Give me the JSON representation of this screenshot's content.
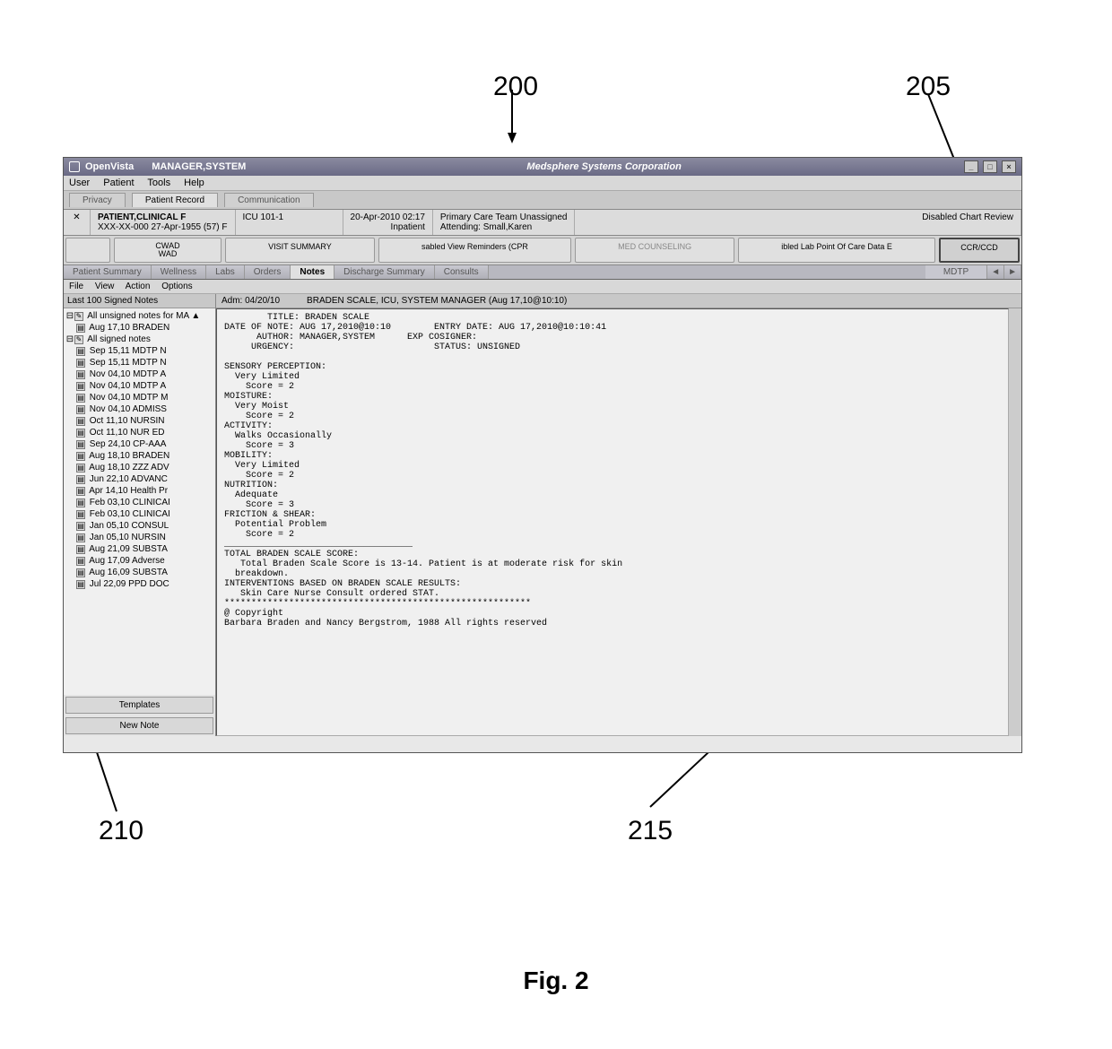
{
  "callouts": {
    "c200": "200",
    "c205": "205",
    "c210": "210",
    "c215": "215",
    "fig": "Fig. 2"
  },
  "titlebar": {
    "app": "OpenVista",
    "user": "MANAGER,SYSTEM",
    "center": "Medsphere Systems Corporation"
  },
  "menus": [
    "User",
    "Patient",
    "Tools",
    "Help"
  ],
  "tabrow1": [
    {
      "label": "Privacy"
    },
    {
      "label": "Patient Record",
      "active": true
    },
    {
      "label": "Communication"
    }
  ],
  "patient": {
    "name": "PATIENT,CLINICAL F",
    "ssn_dob_sex": "XXX-XX-000 27-Apr-1955 (57)   F",
    "loc": "ICU  101-1",
    "datetime": "20-Apr-2010 02:17",
    "inout": "Inpatient",
    "team": "Primary Care Team Unassigned",
    "attending": "Attending: Small,Karen",
    "right": "Disabled Chart Review"
  },
  "btnrow": [
    {
      "label": "",
      "dim": true
    },
    {
      "label": "CWAD\nWAD"
    },
    {
      "label": "VISIT SUMMARY"
    },
    {
      "label": "sabled View Reminders (CPR"
    },
    {
      "label": "MED COUNSELING",
      "dim": true
    },
    {
      "label": "ibled Lab Point Of Care Data E"
    },
    {
      "label": "CCR/CCD",
      "highlight": true
    }
  ],
  "viewtabs": [
    {
      "label": "Patient Summary"
    },
    {
      "label": "Wellness"
    },
    {
      "label": "Labs"
    },
    {
      "label": "Orders"
    },
    {
      "label": "Notes",
      "active": true
    },
    {
      "label": "Discharge Summary"
    },
    {
      "label": "Consults"
    },
    {
      "label": ""
    }
  ],
  "mdtp": "MDTP",
  "submenu": [
    "File",
    "View",
    "Action",
    "Options"
  ],
  "sidehead": "Last 100 Signed Notes",
  "tree": {
    "unsigned_label": "All unsigned notes for MA",
    "unsigned_items": [
      "Aug 17,10 BRADEN"
    ],
    "signed_label": "All signed notes",
    "signed_items": [
      "Sep 15,11 MDTP N",
      "Sep 15,11 MDTP N",
      "Nov 04,10 MDTP A",
      "Nov 04,10 MDTP A",
      "Nov 04,10 MDTP M",
      "Nov 04,10 ADMISS",
      "Oct 11,10 NURSIN",
      "Oct 11,10 NUR ED",
      "Sep 24,10 CP-AAA",
      "Aug 18,10 BRADEN",
      "Aug 18,10 ZZZ ADV",
      "Jun 22,10 ADVANC",
      "Apr 14,10 Health Pr",
      "Feb 03,10 CLINICAI",
      "Feb 03,10 CLINICAI",
      "Jan 05,10 CONSUL",
      "Jan 05,10 NURSIN",
      "Aug 21,09 SUBSTA",
      "Aug 17,09 Adverse",
      "Aug 16,09 SUBSTA",
      "Jul 22,09 PPD DOC"
    ]
  },
  "sidebtns": {
    "templates": "Templates",
    "newnote": "New Note"
  },
  "mainhead": {
    "adm": "Adm: 04/20/10",
    "title": "BRADEN SCALE, ICU, SYSTEM MANAGER  (Aug 17,10@10:10)"
  },
  "note": "        TITLE: BRADEN SCALE\nDATE OF NOTE: AUG 17,2010@10:10        ENTRY DATE: AUG 17,2010@10:10:41\n      AUTHOR: MANAGER,SYSTEM      EXP COSIGNER:\n     URGENCY:                          STATUS: UNSIGNED\n\nSENSORY PERCEPTION:\n  Very Limited\n    Score = 2\nMOISTURE:\n  Very Moist\n    Score = 2\nACTIVITY:\n  Walks Occasionally\n    Score = 3\nMOBILITY:\n  Very Limited\n    Score = 2\nNUTRITION:\n  Adequate\n    Score = 3\nFRICTION & SHEAR:\n  Potential Problem\n    Score = 2\n___________________________________\nTOTAL BRADEN SCALE SCORE:\n   Total Braden Scale Score is 13-14. Patient is at moderate risk for skin\n  breakdown.\nINTERVENTIONS BASED ON BRADEN SCALE RESULTS:\n   Skin Care Nurse Consult ordered STAT.\n*********************************************************\n@ Copyright\nBarbara Braden and Nancy Bergstrom, 1988 All rights reserved"
}
